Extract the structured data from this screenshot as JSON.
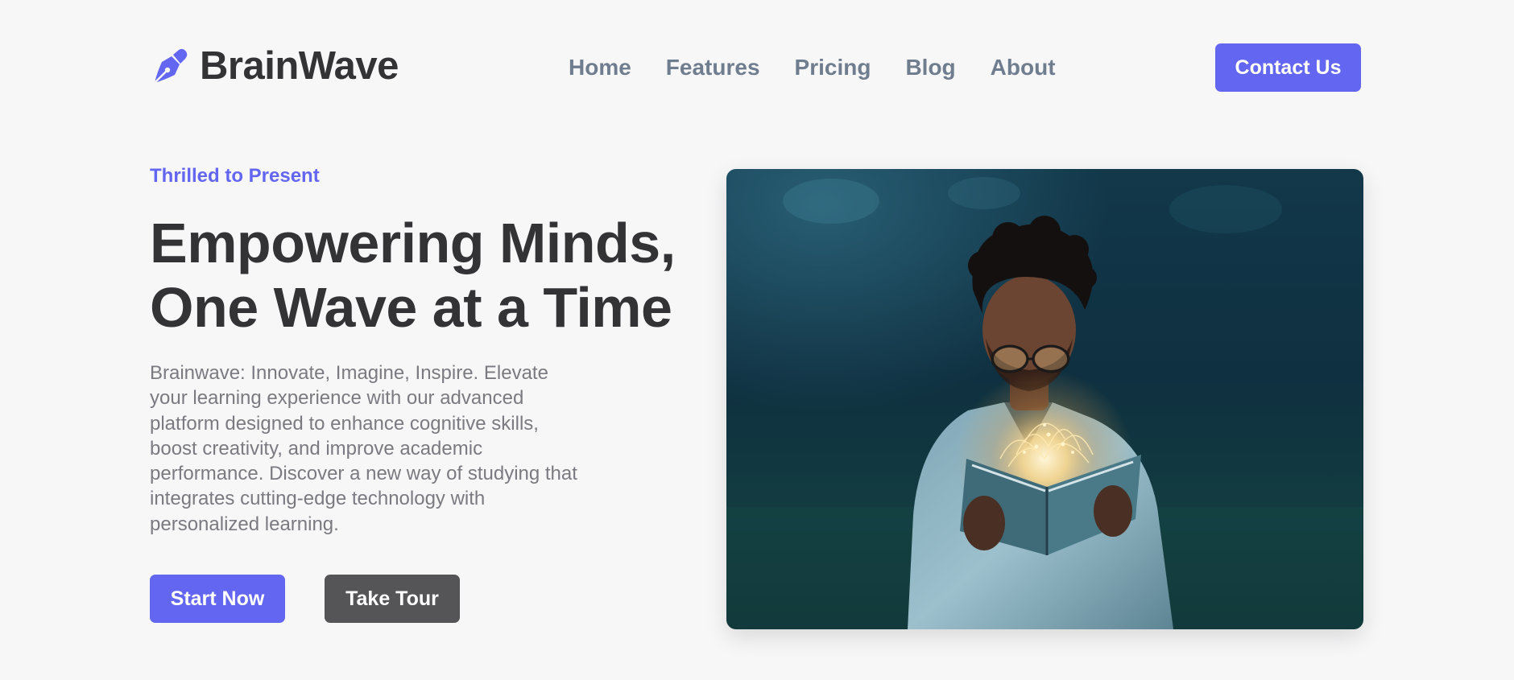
{
  "brand": {
    "name": "BrainWave",
    "icon": "fountain-pen-nib-icon",
    "accent_color": "#6366f1"
  },
  "nav": {
    "items": [
      {
        "label": "Home"
      },
      {
        "label": "Features"
      },
      {
        "label": "Pricing"
      },
      {
        "label": "Blog"
      },
      {
        "label": "About"
      }
    ],
    "contact_label": "Contact Us"
  },
  "hero": {
    "eyebrow": "Thrilled to Present",
    "title_line1": "Empowering Minds,",
    "title_line2": "One Wave at a Time",
    "description": "Brainwave: Innovate, Imagine, Inspire. Elevate your learning experience with our advanced platform designed to enhance cognitive skills, boost creativity, and improve academic performance. Discover a new way of studying that integrates cutting-edge technology with personalized learning.",
    "primary_button": "Start Now",
    "secondary_button": "Take Tour",
    "secondary_color": "#555558"
  }
}
